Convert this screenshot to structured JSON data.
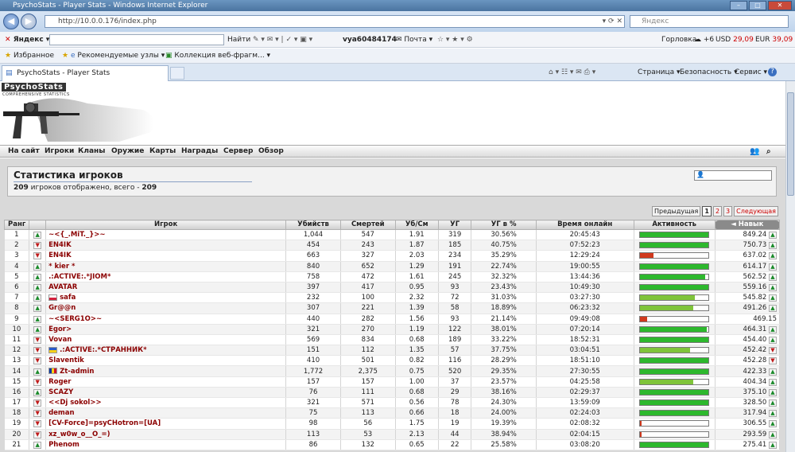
{
  "window": {
    "title": "PsychoStats - Player Stats - Windows Internet Explorer",
    "min": "–",
    "max": "□",
    "close": "✕"
  },
  "address": {
    "url": "http://10.0.0.176/index.php",
    "controls": "▾ ⟳ ✕",
    "search_placeholder": "Яндекс"
  },
  "yandex": {
    "brand": "Яндекс",
    "find": "Найти",
    "user": "vya60484174",
    "mail": "Почта",
    "city": "Горловка",
    "temp": "+6",
    "usd_label": "USD",
    "usd": "29,09",
    "eur_label": "EUR",
    "eur": "39,09"
  },
  "favorites": {
    "label": "Избранное",
    "rec": "Рекомендуемые узлы ▾",
    "gallery": "Коллекция веб-фрагм... ▾"
  },
  "tab": {
    "title": "PsychoStats - Player Stats"
  },
  "cmdbar": {
    "page": "Страница ▾",
    "security": "Безопасность ▾",
    "tools": "Сервис ▾",
    "help": "?"
  },
  "site": {
    "logo": "PsychoStats",
    "logo_sub": "COMPREHENSIVE STATISTICS"
  },
  "nav": [
    "На сайт",
    "Игроки",
    "Кланы",
    "Оружие",
    "Карты",
    "Награды",
    "Сервер",
    "Обзор"
  ],
  "stats": {
    "title": "Статистика игроков",
    "shown": "209",
    "shown_text": " игроков отображено, всего - ",
    "total": "209"
  },
  "pager": {
    "prev": "Предыдущая",
    "p1": "1",
    "p2": "2",
    "p3": "3",
    "next": "Следующая"
  },
  "headers": {
    "rank": "Ранг",
    "player": "Игрок",
    "kills": "Убийств",
    "deaths": "Смертей",
    "kd": "Уб/См",
    "hs": "УГ",
    "hsp": "УГ в %",
    "online": "Время онлайн",
    "activity": "Активность",
    "skill": "Навык"
  },
  "colors": {
    "bar_green": "#2db82d",
    "bar_light": "#7fc43a",
    "bar_red": "#d0391d"
  },
  "players": [
    {
      "rank": "1",
      "trend": "up",
      "name": "~<{_.MiT._}>~",
      "kills": "1,044",
      "deaths": "547",
      "kd": "1.91",
      "hs": "319",
      "hsp": "30.56%",
      "online": "20:45:43",
      "act": 100,
      "skill": "849.24",
      "strend": "up"
    },
    {
      "rank": "2",
      "trend": "down",
      "name": "EN4IK",
      "kills": "454",
      "deaths": "243",
      "kd": "1.87",
      "hs": "185",
      "hsp": "40.75%",
      "online": "07:52:23",
      "act": 100,
      "skill": "750.73",
      "strend": "up"
    },
    {
      "rank": "3",
      "trend": "down",
      "name": "EN4IK",
      "kills": "663",
      "deaths": "327",
      "kd": "2.03",
      "hs": "234",
      "hsp": "35.29%",
      "online": "12:29:24",
      "act": 20,
      "skill": "637.02",
      "strend": "up"
    },
    {
      "rank": "4",
      "trend": "up",
      "name": "* kier *",
      "kills": "840",
      "deaths": "652",
      "kd": "1.29",
      "hs": "191",
      "hsp": "22.74%",
      "online": "19:00:55",
      "act": 100,
      "skill": "614.17",
      "strend": "up"
    },
    {
      "rank": "5",
      "trend": "up",
      "name": ".:ACTIVE:.*JIOM*",
      "kills": "758",
      "deaths": "472",
      "kd": "1.61",
      "hs": "245",
      "hsp": "32.32%",
      "online": "13:44:36",
      "act": 95,
      "skill": "562.52",
      "strend": "up"
    },
    {
      "rank": "6",
      "trend": "up",
      "name": "AVATAR",
      "kills": "397",
      "deaths": "417",
      "kd": "0.95",
      "hs": "93",
      "hsp": "23.43%",
      "online": "10:49:30",
      "act": 100,
      "skill": "559.16",
      "strend": "up"
    },
    {
      "rank": "7",
      "trend": "up",
      "name": "safa",
      "flag": "pl",
      "kills": "232",
      "deaths": "100",
      "kd": "2.32",
      "hs": "72",
      "hsp": "31.03%",
      "online": "03:27:30",
      "act": 80,
      "skill": "545.82",
      "strend": "up"
    },
    {
      "rank": "8",
      "trend": "up",
      "name": "Gr@@n",
      "kills": "307",
      "deaths": "221",
      "kd": "1.39",
      "hs": "58",
      "hsp": "18.89%",
      "online": "06:23:32",
      "act": 78,
      "skill": "491.26",
      "strend": "up"
    },
    {
      "rank": "9",
      "trend": "up",
      "name": "~<SERG1O>~",
      "kills": "440",
      "deaths": "282",
      "kd": "1.56",
      "hs": "93",
      "hsp": "21.14%",
      "online": "09:49:08",
      "act": 10,
      "skill": "469.15",
      "strend": "none"
    },
    {
      "rank": "10",
      "trend": "up",
      "name": "Egor>",
      "kills": "321",
      "deaths": "270",
      "kd": "1.19",
      "hs": "122",
      "hsp": "38.01%",
      "online": "07:20:14",
      "act": 98,
      "skill": "464.31",
      "strend": "up"
    },
    {
      "rank": "11",
      "trend": "down",
      "name": "Vovan",
      "kills": "569",
      "deaths": "834",
      "kd": "0.68",
      "hs": "189",
      "hsp": "33.22%",
      "online": "18:52:31",
      "act": 100,
      "skill": "454.40",
      "strend": "up"
    },
    {
      "rank": "12",
      "trend": "down",
      "name": ".:ACTIVE:.*СТРАННИК*",
      "flag": "ua",
      "kills": "151",
      "deaths": "112",
      "kd": "1.35",
      "hs": "57",
      "hsp": "37.75%",
      "online": "03:04:51",
      "act": 73,
      "skill": "452.42",
      "strend": "down"
    },
    {
      "rank": "13",
      "trend": "down",
      "name": "Slaventik",
      "kills": "410",
      "deaths": "501",
      "kd": "0.82",
      "hs": "116",
      "hsp": "28.29%",
      "online": "18:51:10",
      "act": 100,
      "skill": "452.28",
      "strend": "down"
    },
    {
      "rank": "14",
      "trend": "up",
      "name": "Zt-admin",
      "flag": "ro",
      "kills": "1,772",
      "deaths": "2,375",
      "kd": "0.75",
      "hs": "520",
      "hsp": "29.35%",
      "online": "27:30:55",
      "act": 100,
      "skill": "422.33",
      "strend": "up"
    },
    {
      "rank": "15",
      "trend": "down",
      "name": "Roger",
      "kills": "157",
      "deaths": "157",
      "kd": "1.00",
      "hs": "37",
      "hsp": "23.57%",
      "online": "04:25:58",
      "act": 78,
      "skill": "404.34",
      "strend": "up"
    },
    {
      "rank": "16",
      "trend": "up",
      "name": "SCAZY",
      "kills": "76",
      "deaths": "111",
      "kd": "0.68",
      "hs": "29",
      "hsp": "38.16%",
      "online": "02:29:37",
      "act": 100,
      "skill": "375.10",
      "strend": "up"
    },
    {
      "rank": "17",
      "trend": "down",
      "name": "<<Dj sokol>>",
      "kills": "321",
      "deaths": "571",
      "kd": "0.56",
      "hs": "78",
      "hsp": "24.30%",
      "online": "13:59:09",
      "act": 100,
      "skill": "328.50",
      "strend": "up"
    },
    {
      "rank": "18",
      "trend": "down",
      "name": "deman",
      "kills": "75",
      "deaths": "113",
      "kd": "0.66",
      "hs": "18",
      "hsp": "24.00%",
      "online": "02:24:03",
      "act": 100,
      "skill": "317.94",
      "strend": "up"
    },
    {
      "rank": "19",
      "trend": "down",
      "name": "[CV-Force]=psyCHotron=[UA]",
      "kills": "98",
      "deaths": "56",
      "kd": "1.75",
      "hs": "19",
      "hsp": "19.39%",
      "online": "02:08:32",
      "act": 2,
      "skill": "306.55",
      "strend": "up"
    },
    {
      "rank": "20",
      "trend": "down",
      "name": "xz_w0w_o__O_=)",
      "kills": "113",
      "deaths": "53",
      "kd": "2.13",
      "hs": "44",
      "hsp": "38.94%",
      "online": "02:04:15",
      "act": 2,
      "skill": "293.59",
      "strend": "up"
    },
    {
      "rank": "21",
      "trend": "up",
      "name": "Phenom",
      "kills": "86",
      "deaths": "132",
      "kd": "0.65",
      "hs": "22",
      "hsp": "25.58%",
      "online": "03:08:20",
      "act": 100,
      "skill": "275.41",
      "strend": "up"
    }
  ]
}
